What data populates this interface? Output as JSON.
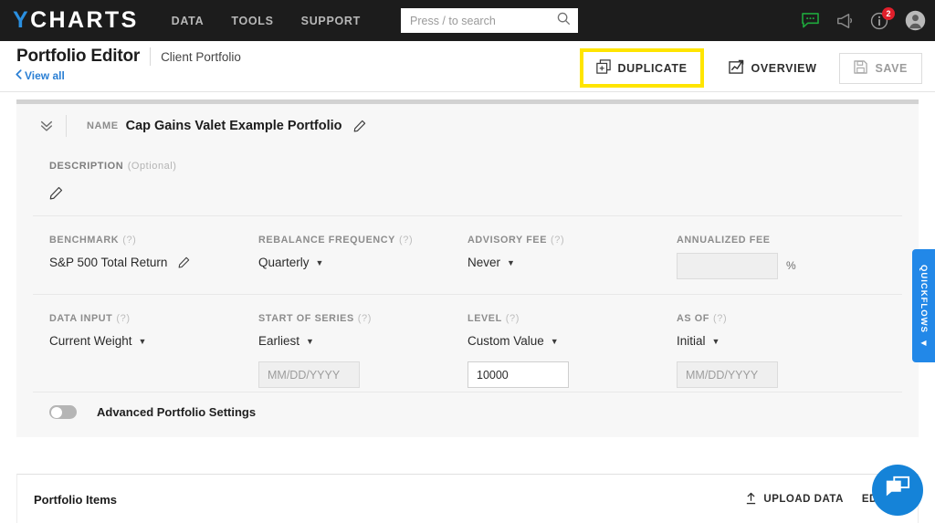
{
  "topnav": {
    "logo_y": "Y",
    "logo_rest": "CHARTS",
    "links": [
      {
        "label": "DATA"
      },
      {
        "label": "TOOLS"
      },
      {
        "label": "SUPPORT"
      }
    ],
    "search": {
      "placeholder": "Press / to search",
      "value": ""
    },
    "icons": {
      "chat": "chat-bubble-icon",
      "announce": "megaphone-icon",
      "info": "info-icon",
      "avatar": "user-avatar-icon"
    },
    "info_badge": "2",
    "colors": {
      "bar": "#1c1c1c",
      "logo_accent": "#2a8fe0",
      "badge": "#e01f2b"
    }
  },
  "pagehead": {
    "title": "Portfolio Editor",
    "subtitle": "Client Portfolio",
    "view_all": "View all",
    "actions": {
      "duplicate": "DUPLICATE",
      "overview": "OVERVIEW",
      "save": "SAVE"
    },
    "highlight_color": "#ffe500"
  },
  "card": {
    "name": {
      "label": "NAME",
      "value": "Cap Gains Valet Example Portfolio"
    },
    "description": {
      "label": "DESCRIPTION",
      "optional": "(Optional)"
    },
    "fields": [
      {
        "label": "BENCHMARK",
        "help": "(?)",
        "value": "S&P 500 Total Return",
        "control": "text-pencil"
      },
      {
        "label": "REBALANCE FREQUENCY",
        "help": "(?)",
        "value": "Quarterly",
        "control": "dropdown"
      },
      {
        "label": "ADVISORY FEE",
        "help": "(?)",
        "value": "Never",
        "control": "dropdown"
      },
      {
        "label": "ANNUALIZED FEE",
        "help": "",
        "value": "",
        "control": "input-disabled",
        "input_value": "",
        "suffix": "%"
      }
    ],
    "fields2": [
      {
        "label": "DATA INPUT",
        "help": "(?)",
        "value": "Current Weight",
        "control": "dropdown",
        "input_value": "",
        "input_placeholder": ""
      },
      {
        "label": "START OF SERIES",
        "help": "(?)",
        "value": "Earliest",
        "control": "dropdown",
        "input_value": "",
        "input_placeholder": "MM/DD/YYYY"
      },
      {
        "label": "LEVEL",
        "help": "(?)",
        "value": "Custom Value",
        "control": "dropdown",
        "input_value": "10000",
        "input_placeholder": ""
      },
      {
        "label": "AS OF",
        "help": "(?)",
        "value": "Initial",
        "control": "dropdown",
        "input_value": "",
        "input_placeholder": "MM/DD/YYYY"
      }
    ],
    "advanced_toggle": {
      "label": "Advanced Portfolio Settings",
      "state": "off"
    }
  },
  "items": {
    "title": "Portfolio Items",
    "upload": "UPLOAD DATA",
    "edit": "EDIT IT"
  },
  "quickflows": {
    "label": "QUICKFLOWS",
    "arrow": "◀",
    "color": "#2288e8"
  },
  "chat_fab": {
    "icon": "chat-bubbles-icon",
    "color": "#1583d8"
  }
}
